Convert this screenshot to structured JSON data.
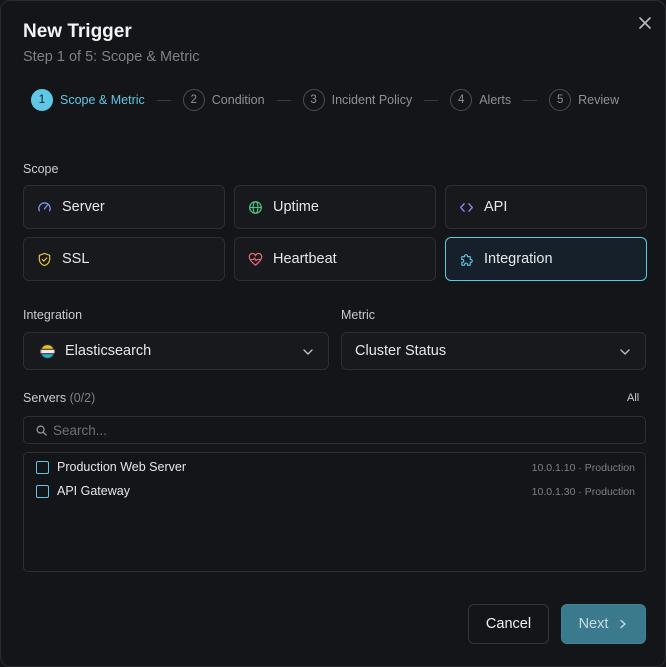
{
  "dialog": {
    "title": "New Trigger",
    "subtitle": "Step 1 of 5: Scope & Metric"
  },
  "steps": [
    {
      "num": "1",
      "label": "Scope & Metric",
      "active": true
    },
    {
      "num": "2",
      "label": "Condition",
      "active": false
    },
    {
      "num": "3",
      "label": "Incident Policy",
      "active": false
    },
    {
      "num": "4",
      "label": "Alerts",
      "active": false
    },
    {
      "num": "5",
      "label": "Review",
      "active": false
    }
  ],
  "scope": {
    "label": "Scope",
    "options": [
      {
        "label": "Server",
        "icon": "gauge-icon",
        "selected": false
      },
      {
        "label": "Uptime",
        "icon": "globe-icon",
        "selected": false
      },
      {
        "label": "API",
        "icon": "code-icon",
        "selected": false
      },
      {
        "label": "SSL",
        "icon": "shield-icon",
        "selected": false
      },
      {
        "label": "Heartbeat",
        "icon": "heart-pulse-icon",
        "selected": false
      },
      {
        "label": "Integration",
        "icon": "puzzle-icon",
        "selected": true
      }
    ]
  },
  "integration": {
    "label": "Integration",
    "value": "Elasticsearch",
    "icon": "elasticsearch-logo"
  },
  "metric": {
    "label": "Metric",
    "value": "Cluster Status"
  },
  "servers": {
    "label": "Servers",
    "count": "(0/2)",
    "all_label": "All",
    "search_placeholder": "Search...",
    "items": [
      {
        "name": "Production Web Server",
        "meta": "10.0.1.10 · Production",
        "checked": false
      },
      {
        "name": "API Gateway",
        "meta": "10.0.1.30 · Production",
        "checked": false
      }
    ]
  },
  "footer": {
    "cancel_label": "Cancel",
    "next_label": "Next"
  },
  "colors": {
    "accent": "#5ec8e6",
    "background": "#141518",
    "card": "#18191d",
    "border": "#2d2f35",
    "next_button": "#3b7a8c"
  }
}
